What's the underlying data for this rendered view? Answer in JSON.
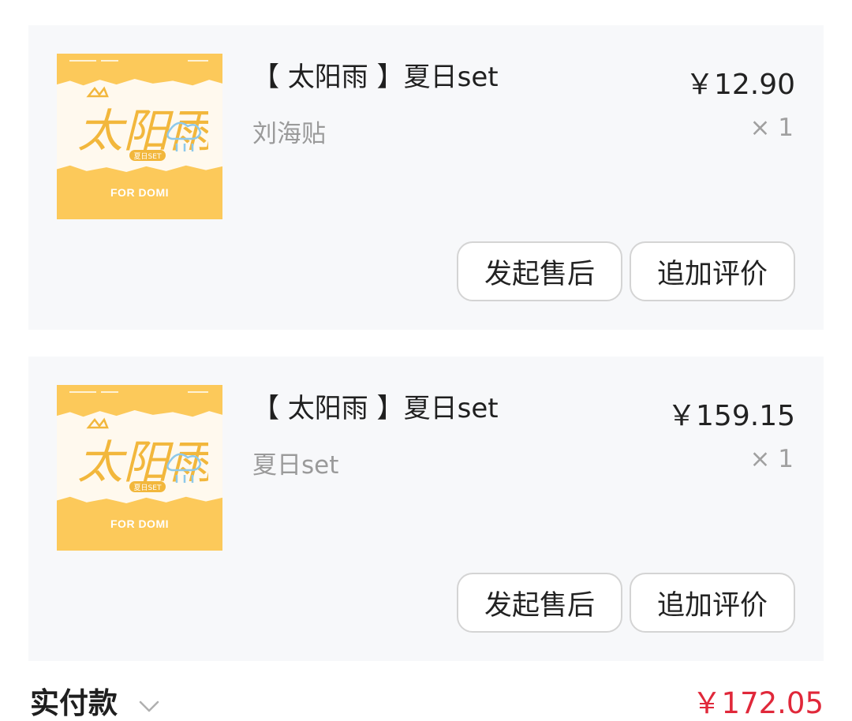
{
  "order_items": [
    {
      "title": "【 太阳雨 】夏日set",
      "variant": "刘海贴",
      "price": "￥12.90",
      "quantity": "× 1",
      "thumbnail": {
        "art_text": "太阳雨",
        "badge": "夏日SET",
        "caption": "FOR DOMI"
      },
      "buttons": {
        "after_sale": "发起售后",
        "add_review": "追加评价"
      }
    },
    {
      "title": "【 太阳雨 】夏日set",
      "variant": "夏日set",
      "price": "￥159.15",
      "quantity": "× 1",
      "thumbnail": {
        "art_text": "太阳雨",
        "badge": "夏日SET",
        "caption": "FOR DOMI"
      },
      "buttons": {
        "after_sale": "发起售后",
        "add_review": "追加评价"
      }
    }
  ],
  "footer": {
    "label": "实付款",
    "total": "￥172.05",
    "expand_icon": "chevron-down-icon"
  },
  "colors": {
    "card_bg": "#f7f8fa",
    "thumb_yellow": "#fcc95a",
    "total_red": "#e0283a",
    "muted_text": "#9a9a9a"
  }
}
